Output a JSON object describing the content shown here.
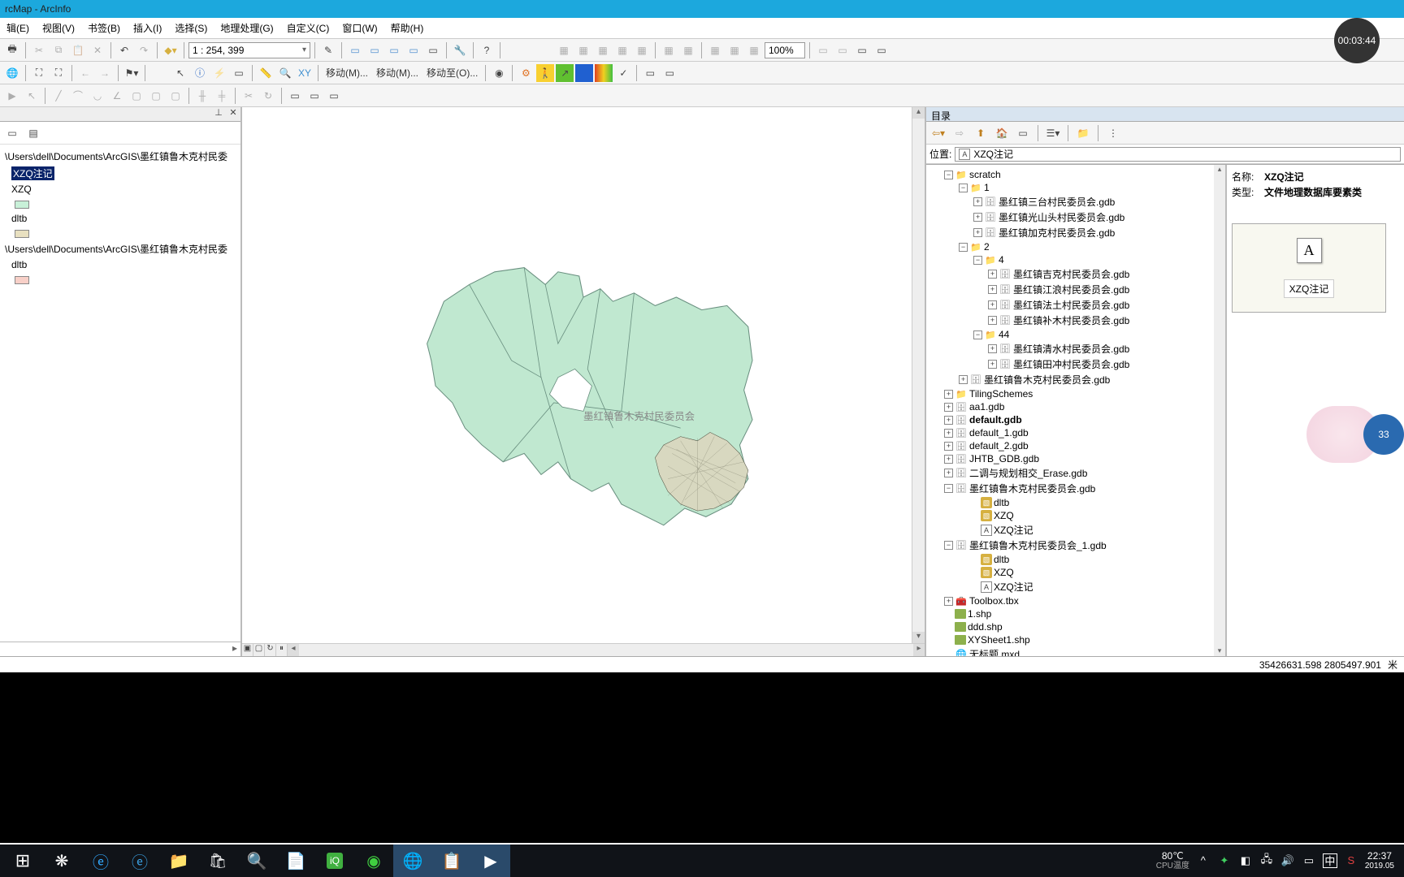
{
  "title": "rcMap - ArcInfo",
  "menu": [
    "辑(E)",
    "视图(V)",
    "书签(B)",
    "插入(I)",
    "选择(S)",
    "地理处理(G)",
    "自定义(C)",
    "窗口(W)",
    "帮助(H)"
  ],
  "scale": "1 : 254, 399",
  "zoom": "100%",
  "nav_texts": [
    "移动(M)...",
    "移动(M)...",
    "移动至(O)..."
  ],
  "toc": {
    "path1": "\\Users\\dell\\Documents\\ArcGIS\\墨红镇鲁木克村民委",
    "layer1": "XZQ注记",
    "layer2": "XZQ",
    "layer3": "dltb",
    "path2": "\\Users\\dell\\Documents\\ArcGIS\\墨红镇鲁木克村民委",
    "layer4": "dltb"
  },
  "catalog": {
    "title": "目录",
    "loc_label": "位置:",
    "loc_value": "XZQ注记",
    "tree": {
      "scratch": "scratch",
      "f1": "1",
      "f1_items": [
        "墨红镇三台村民委员会.gdb",
        "墨红镇光山头村民委员会.gdb",
        "墨红镇加克村民委员会.gdb"
      ],
      "f2": "2",
      "f4": "4",
      "f4_items": [
        "墨红镇吉克村民委员会.gdb",
        "墨红镇江浪村民委员会.gdb",
        "墨红镇法土村民委员会.gdb",
        "墨红镇补木村民委员会.gdb"
      ],
      "f44": "44",
      "f44_items": [
        "墨红镇清水村民委员会.gdb",
        "墨红镇田冲村民委员会.gdb"
      ],
      "root_gdb1": "墨红镇鲁木克村民委员会.gdb",
      "tiling": "TilingSchemes",
      "aa1": "aa1.gdb",
      "default": "default.gdb",
      "default1": "default_1.gdb",
      "default2": "default_2.gdb",
      "jhtb": "JHTB_GDB.gdb",
      "erase": "二调与规划相交_Erase.gdb",
      "main_gdb": "墨红镇鲁木克村民委员会.gdb",
      "main_gdb_items": [
        "dltb",
        "XZQ",
        "XZQ注记"
      ],
      "main_gdb1": "墨红镇鲁木克村民委员会_1.gdb",
      "main_gdb1_items": [
        "dltb",
        "XZQ",
        "XZQ注记"
      ],
      "toolbox": "Toolbox.tbx",
      "shp1": "1.shp",
      "shp2": "ddd.shp",
      "shp3": "XYSheet1.shp",
      "mxd": "无标题.mxd"
    }
  },
  "preview": {
    "name_label": "名称:",
    "name_value": "XZQ注记",
    "type_label": "类型:",
    "type_value": "文件地理数据库要素类",
    "thumb_icon": "A",
    "thumb_caption": "XZQ注记"
  },
  "status": {
    "coords": "35426631.598  2805497.901",
    "unit": "米"
  },
  "timer": "00:03:44",
  "float_num": "33",
  "taskbar": {
    "temp": "80℃",
    "temp_label": "CPU温度",
    "time": "22:37",
    "date": "2019.05",
    "ime": "中"
  }
}
